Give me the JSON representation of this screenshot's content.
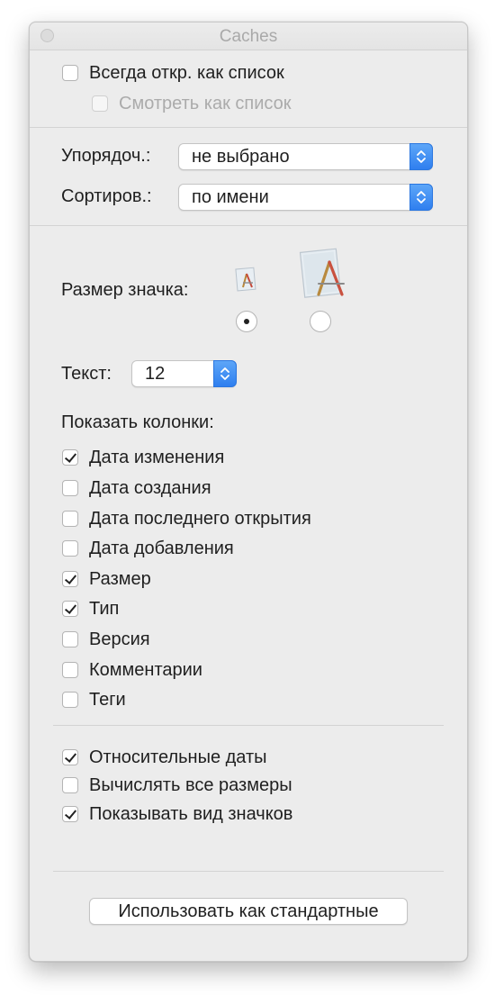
{
  "window": {
    "title": "Caches"
  },
  "top_options": [
    {
      "label": "Всегда откр. как список",
      "checked": false,
      "disabled": false
    },
    {
      "label": "Смотреть как список",
      "checked": false,
      "disabled": true
    }
  ],
  "arrange": {
    "label": "Упорядоч.:",
    "value": "не выбрано"
  },
  "sort": {
    "label": "Сортиров.:",
    "value": "по имени"
  },
  "icon_size": {
    "label": "Размер значка:",
    "selected": "small"
  },
  "text_size": {
    "label": "Текст:",
    "value": "12"
  },
  "columns": {
    "heading": "Показать колонки:",
    "items": [
      {
        "label": "Дата изменения",
        "checked": true
      },
      {
        "label": "Дата создания",
        "checked": false
      },
      {
        "label": "Дата последнего открытия",
        "checked": false
      },
      {
        "label": "Дата добавления",
        "checked": false
      },
      {
        "label": "Размер",
        "checked": true
      },
      {
        "label": "Тип",
        "checked": true
      },
      {
        "label": "Версия",
        "checked": false
      },
      {
        "label": "Комментарии",
        "checked": false
      },
      {
        "label": "Теги",
        "checked": false
      }
    ]
  },
  "extra_options": [
    {
      "label": "Относительные даты",
      "checked": true
    },
    {
      "label": "Вычислять все размеры",
      "checked": false
    },
    {
      "label": "Показывать вид значков",
      "checked": true
    }
  ],
  "default_button": {
    "label": "Использовать как стандартные"
  },
  "colors": {
    "accent": "#3b86f5",
    "window_bg": "#ececec"
  }
}
